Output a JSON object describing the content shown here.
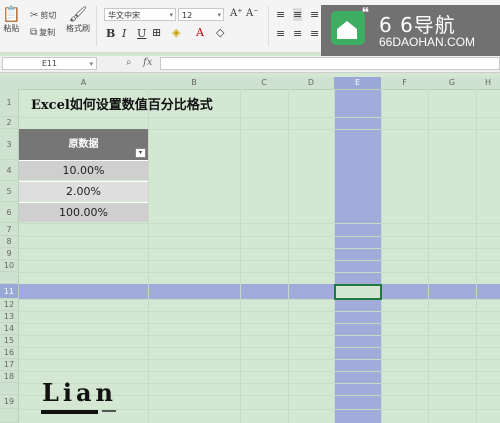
{
  "ribbon": {
    "paste_label": "粘贴",
    "cut_label": "剪切",
    "copy_label": "复制",
    "format_painter_label": "格式刷",
    "font_name": "华文中宋",
    "font_size": "12",
    "bold": "B",
    "italic": "I",
    "underline": "U",
    "grow_font": "A⁺",
    "shrink_font": "A⁻"
  },
  "watermark": {
    "title": "6 6导航",
    "url": "66DAOHAN.COM"
  },
  "formula_bar": {
    "name_box": "E11",
    "fx": "fx"
  },
  "columns": [
    "A",
    "B",
    "C",
    "D",
    "E",
    "F",
    "G",
    "H"
  ],
  "rows": [
    "1",
    "2",
    "3",
    "4",
    "5",
    "6",
    "7",
    "8",
    "9",
    "10",
    "11",
    "12",
    "13",
    "14",
    "15",
    "16",
    "17",
    "18",
    "19"
  ],
  "selected_column": "E",
  "selected_row": "11",
  "sheet": {
    "title": "Excel如何设置数值百分比格式",
    "table_header": "原数据",
    "values": [
      "10.00%",
      "2.00%",
      "100.00%"
    ]
  },
  "signature": "Lian",
  "colors": {
    "sheet_bg": "#d3e7d3",
    "selection": "#a2abdc",
    "active_border": "#1e7a3e",
    "header_fill": "#767676"
  }
}
